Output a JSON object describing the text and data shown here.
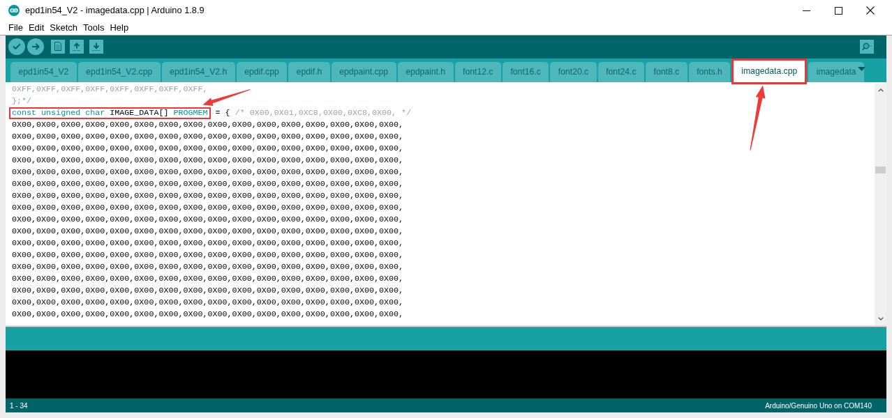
{
  "window": {
    "title": "epd1in54_V2 - imagedata.cpp | Arduino 1.8.9"
  },
  "menu": [
    "File",
    "Edit",
    "Sketch",
    "Tools",
    "Help"
  ],
  "tabs": [
    {
      "label": "epd1in54_V2",
      "selected": false,
      "highlighted": false
    },
    {
      "label": "epd1in54_V2.cpp",
      "selected": false,
      "highlighted": false
    },
    {
      "label": "epd1in54_V2.h",
      "selected": false,
      "highlighted": false
    },
    {
      "label": "epdif.cpp",
      "selected": false,
      "highlighted": false
    },
    {
      "label": "epdif.h",
      "selected": false,
      "highlighted": false
    },
    {
      "label": "epdpaint.cpp",
      "selected": false,
      "highlighted": false
    },
    {
      "label": "epdpaint.h",
      "selected": false,
      "highlighted": false
    },
    {
      "label": "font12.c",
      "selected": false,
      "highlighted": false
    },
    {
      "label": "font16.c",
      "selected": false,
      "highlighted": false
    },
    {
      "label": "font20.c",
      "selected": false,
      "highlighted": false
    },
    {
      "label": "font24.c",
      "selected": false,
      "highlighted": false
    },
    {
      "label": "font8.c",
      "selected": false,
      "highlighted": false
    },
    {
      "label": "fonts.h",
      "selected": false,
      "highlighted": false
    },
    {
      "label": "imagedata.cpp",
      "selected": true,
      "highlighted": true
    },
    {
      "label": "imagedata",
      "selected": false,
      "highlighted": false
    }
  ],
  "editor": {
    "lines": [
      {
        "segments": [
          {
            "highlighted": false,
            "tokens": [
              {
                "kind": "comment",
                "text": "0XFF,0XFF,0XFF,0XFF,0XFF,0XFF,0XFF,0XFF,"
              }
            ]
          }
        ]
      },
      {
        "segments": [
          {
            "highlighted": false,
            "tokens": [
              {
                "kind": "comment",
                "text": "};*/"
              }
            ]
          }
        ]
      },
      {
        "segments": [
          {
            "highlighted": true,
            "tokens": [
              {
                "kind": "keyword",
                "text": "const unsigned char"
              },
              {
                "kind": "plain",
                "text": " IMAGE_DATA[] "
              },
              {
                "kind": "keyword",
                "text": "PROGMEM"
              }
            ]
          },
          {
            "highlighted": false,
            "tokens": [
              {
                "kind": "plain",
                "text": " = { "
              },
              {
                "kind": "comment",
                "text": "/* 0X00,0X01,0XC8,0X00,0XC8,0X00, */"
              }
            ]
          }
        ]
      },
      {
        "segments": [
          {
            "highlighted": false,
            "tokens": [
              {
                "kind": "plain",
                "text": "0X00,0X00,0X00,0X00,0X00,0X00,0X00,0X00,0X00,0X00,0X00,0X00,0X00,0X00,0X00,0X00,"
              }
            ]
          }
        ]
      },
      {
        "segments": [
          {
            "highlighted": false,
            "tokens": [
              {
                "kind": "plain",
                "text": "0X00,0X00,0X00,0X00,0X00,0X00,0X00,0X00,0X00,0X00,0X00,0X00,0X00,0X00,0X00,0X00,"
              }
            ]
          }
        ]
      },
      {
        "segments": [
          {
            "highlighted": false,
            "tokens": [
              {
                "kind": "plain",
                "text": "0X00,0X00,0X00,0X00,0X00,0X00,0X00,0X00,0X00,0X00,0X00,0X00,0X00,0X00,0X00,0X00,"
              }
            ]
          }
        ]
      },
      {
        "segments": [
          {
            "highlighted": false,
            "tokens": [
              {
                "kind": "plain",
                "text": "0X00,0X00,0X00,0X00,0X00,0X00,0X00,0X00,0X00,0X00,0X00,0X00,0X00,0X00,0X00,0X00,"
              }
            ]
          }
        ]
      },
      {
        "segments": [
          {
            "highlighted": false,
            "tokens": [
              {
                "kind": "plain",
                "text": "0X00,0X00,0X00,0X00,0X00,0X00,0X00,0X00,0X00,0X00,0X00,0X00,0X00,0X00,0X00,0X00,"
              }
            ]
          }
        ]
      },
      {
        "segments": [
          {
            "highlighted": false,
            "tokens": [
              {
                "kind": "plain",
                "text": "0X00,0X00,0X00,0X00,0X00,0X00,0X00,0X00,0X00,0X00,0X00,0X00,0X00,0X00,0X00,0X00,"
              }
            ]
          }
        ]
      },
      {
        "segments": [
          {
            "highlighted": false,
            "tokens": [
              {
                "kind": "plain",
                "text": "0X00,0X00,0X00,0X00,0X00,0X00,0X00,0X00,0X00,0X00,0X00,0X00,0X00,0X00,0X00,0X00,"
              }
            ]
          }
        ]
      },
      {
        "segments": [
          {
            "highlighted": false,
            "tokens": [
              {
                "kind": "plain",
                "text": "0X00,0X00,0X00,0X00,0X00,0X00,0X00,0X00,0X00,0X00,0X00,0X00,0X00,0X00,0X00,0X00,"
              }
            ]
          }
        ]
      },
      {
        "segments": [
          {
            "highlighted": false,
            "tokens": [
              {
                "kind": "plain",
                "text": "0X00,0X00,0X00,0X00,0X00,0X00,0X00,0X00,0X00,0X00,0X00,0X00,0X00,0X00,0X00,0X00,"
              }
            ]
          }
        ]
      },
      {
        "segments": [
          {
            "highlighted": false,
            "tokens": [
              {
                "kind": "plain",
                "text": "0X00,0X00,0X00,0X00,0X00,0X00,0X00,0X00,0X00,0X00,0X00,0X00,0X00,0X00,0X00,0X00,"
              }
            ]
          }
        ]
      },
      {
        "segments": [
          {
            "highlighted": false,
            "tokens": [
              {
                "kind": "plain",
                "text": "0X00,0X00,0X00,0X00,0X00,0X00,0X00,0X00,0X00,0X00,0X00,0X00,0X00,0X00,0X00,0X00,"
              }
            ]
          }
        ]
      },
      {
        "segments": [
          {
            "highlighted": false,
            "tokens": [
              {
                "kind": "plain",
                "text": "0X00,0X00,0X00,0X00,0X00,0X00,0X00,0X00,0X00,0X00,0X00,0X00,0X00,0X00,0X00,0X00,"
              }
            ]
          }
        ]
      },
      {
        "segments": [
          {
            "highlighted": false,
            "tokens": [
              {
                "kind": "plain",
                "text": "0X00,0X00,0X00,0X00,0X00,0X00,0X00,0X00,0X00,0X00,0X00,0X00,0X00,0X00,0X00,0X00,"
              }
            ]
          }
        ]
      },
      {
        "segments": [
          {
            "highlighted": false,
            "tokens": [
              {
                "kind": "plain",
                "text": "0X00,0X00,0X00,0X00,0X00,0X00,0X00,0X00,0X00,0X00,0X00,0X00,0X00,0X00,0X00,0X00,"
              }
            ]
          }
        ]
      },
      {
        "segments": [
          {
            "highlighted": false,
            "tokens": [
              {
                "kind": "plain",
                "text": "0X00,0X00,0X00,0X00,0X00,0X00,0X00,0X00,0X00,0X00,0X00,0X00,0X00,0X00,0X00,0X00,"
              }
            ]
          }
        ]
      },
      {
        "segments": [
          {
            "highlighted": false,
            "tokens": [
              {
                "kind": "plain",
                "text": "0X00,0X00,0X00,0X00,0X00,0X00,0X00,0X00,0X00,0X00,0X00,0X00,0X00,0X00,0X00,0X00,"
              }
            ]
          }
        ]
      },
      {
        "segments": [
          {
            "highlighted": false,
            "tokens": [
              {
                "kind": "plain",
                "text": "0X00,0X00,0X00,0X00,0X00,0X00,0X00,0X00,0X00,0X00,0X00,0X00,0X00,0X00,0X00,0X00,"
              }
            ]
          }
        ]
      }
    ]
  },
  "status_bar": {
    "line_range": "1 - 34",
    "board": "Arduino/Genuino Uno on COM140"
  }
}
